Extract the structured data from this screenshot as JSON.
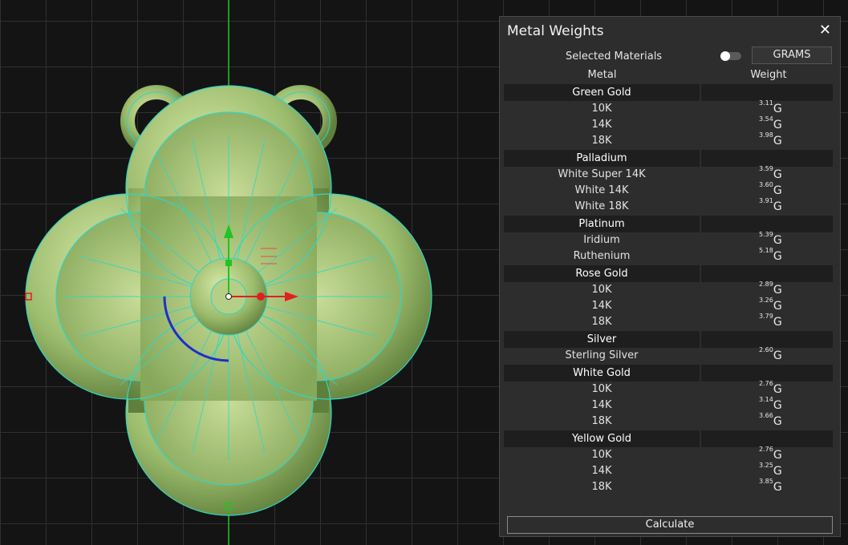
{
  "panel": {
    "title": "Metal Weights",
    "close_icon": "close-icon",
    "selected_materials_label": "Selected Materials",
    "selected_materials_on": false,
    "units_label": "GRAMS",
    "col_metal": "Metal",
    "col_weight": "Weight",
    "calculate_label": "Calculate",
    "unit_suffix": "G",
    "groups": [
      {
        "name": "Green Gold",
        "rows": [
          {
            "name": "10K",
            "weight": "3.11"
          },
          {
            "name": "14K",
            "weight": "3.54"
          },
          {
            "name": "18K",
            "weight": "3.98"
          }
        ]
      },
      {
        "name": "Palladium",
        "rows": [
          {
            "name": "White Super 14K",
            "weight": "3.59"
          },
          {
            "name": "White 14K",
            "weight": "3.60"
          },
          {
            "name": "White 18K",
            "weight": "3.91"
          }
        ]
      },
      {
        "name": "Platinum",
        "rows": [
          {
            "name": "Iridium",
            "weight": "5.39"
          },
          {
            "name": "Ruthenium",
            "weight": "5.18"
          }
        ]
      },
      {
        "name": "Rose Gold",
        "rows": [
          {
            "name": "10K",
            "weight": "2.89"
          },
          {
            "name": "14K",
            "weight": "3.26"
          },
          {
            "name": "18K",
            "weight": "3.79"
          }
        ]
      },
      {
        "name": "Silver",
        "rows": [
          {
            "name": "Sterling Silver",
            "weight": "2.60"
          }
        ]
      },
      {
        "name": "White Gold",
        "rows": [
          {
            "name": "10K",
            "weight": "2.76"
          },
          {
            "name": "14K",
            "weight": "3.14"
          },
          {
            "name": "18K",
            "weight": "3.66"
          }
        ]
      },
      {
        "name": "Yellow Gold",
        "rows": [
          {
            "name": "10K",
            "weight": "2.76"
          },
          {
            "name": "14K",
            "weight": "3.25"
          },
          {
            "name": "18K",
            "weight": "3.85"
          }
        ]
      }
    ]
  },
  "viewport": {
    "model": "quatrefoil-pendant",
    "colors": {
      "model": "#a9c77a",
      "wire": "#2fd6c8",
      "axis_y": "#22c322",
      "axis_x": "#e02020",
      "rotate": "#1d2fc9"
    }
  }
}
